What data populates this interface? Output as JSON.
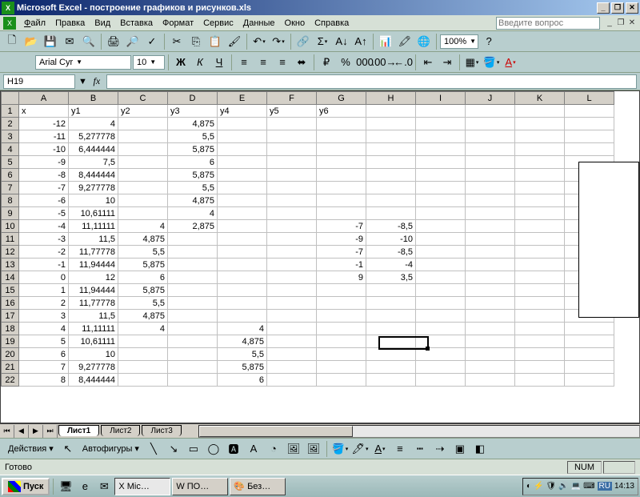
{
  "titlebar": {
    "app": "Microsoft Excel",
    "doc": "построение графиков и рисунков.xls"
  },
  "menu": {
    "file": "Файл",
    "edit": "Правка",
    "view": "Вид",
    "insert": "Вставка",
    "format": "Формат",
    "tools": "Сервис",
    "data": "Данные",
    "window": "Окно",
    "help": "Справка",
    "ask_placeholder": "Введите вопрос"
  },
  "toolbar": {
    "zoom": "100%"
  },
  "format": {
    "font": "Arial Cyr",
    "size": "10",
    "bold": "Ж",
    "italic": "К",
    "underline": "Ч"
  },
  "namebox": "H19",
  "columns": [
    "A",
    "B",
    "C",
    "D",
    "E",
    "F",
    "G",
    "H",
    "I",
    "J",
    "K",
    "L"
  ],
  "headers": {
    "A": "x",
    "B": "y1",
    "C": "y2",
    "D": "y3",
    "E": "y4",
    "F": "y5",
    "G": "y6",
    "H": ""
  },
  "rows": [
    {
      "n": 1
    },
    {
      "n": 2,
      "A": "-12",
      "B": "4",
      "D": "4,875"
    },
    {
      "n": 3,
      "A": "-11",
      "B": "5,277778",
      "D": "5,5"
    },
    {
      "n": 4,
      "A": "-10",
      "B": "6,444444",
      "D": "5,875"
    },
    {
      "n": 5,
      "A": "-9",
      "B": "7,5",
      "D": "6"
    },
    {
      "n": 6,
      "A": "-8",
      "B": "8,444444",
      "D": "5,875"
    },
    {
      "n": 7,
      "A": "-7",
      "B": "9,277778",
      "D": "5,5"
    },
    {
      "n": 8,
      "A": "-6",
      "B": "10",
      "D": "4,875"
    },
    {
      "n": 9,
      "A": "-5",
      "B": "10,61111",
      "D": "4"
    },
    {
      "n": 10,
      "A": "-4",
      "B": "11,11111",
      "C": "4",
      "D": "2,875",
      "G": "-7",
      "H": "-8,5"
    },
    {
      "n": 11,
      "A": "-3",
      "B": "11,5",
      "C": "4,875",
      "G": "-9",
      "H": "-10"
    },
    {
      "n": 12,
      "A": "-2",
      "B": "11,77778",
      "C": "5,5",
      "G": "-7",
      "H": "-8,5"
    },
    {
      "n": 13,
      "A": "-1",
      "B": "11,94444",
      "C": "5,875",
      "G": "-1",
      "H": "-4"
    },
    {
      "n": 14,
      "A": "0",
      "B": "12",
      "C": "6",
      "G": "9",
      "H": "3,5"
    },
    {
      "n": 15,
      "A": "1",
      "B": "11,94444",
      "C": "5,875"
    },
    {
      "n": 16,
      "A": "2",
      "B": "11,77778",
      "C": "5,5"
    },
    {
      "n": 17,
      "A": "3",
      "B": "11,5",
      "C": "4,875"
    },
    {
      "n": 18,
      "A": "4",
      "B": "11,11111",
      "C": "4",
      "E": "4"
    },
    {
      "n": 19,
      "A": "5",
      "B": "10,61111",
      "E": "4,875"
    },
    {
      "n": 20,
      "A": "6",
      "B": "10",
      "E": "5,5"
    },
    {
      "n": 21,
      "A": "7",
      "B": "9,277778",
      "E": "5,875"
    },
    {
      "n": 22,
      "A": "8",
      "B": "8,444444",
      "E": "6"
    }
  ],
  "tabs": {
    "s1": "Лист1",
    "s2": "Лист2",
    "s3": "Лист3"
  },
  "draw": {
    "actions": "Действия",
    "autoshapes": "Автофигуры"
  },
  "status": {
    "ready": "Готово",
    "num": "NUM"
  },
  "taskbar": {
    "start": "Пуск",
    "excel": "Mic…",
    "word": "ПО…",
    "paint": "Без…",
    "lang": "RU",
    "time": "14:13"
  }
}
